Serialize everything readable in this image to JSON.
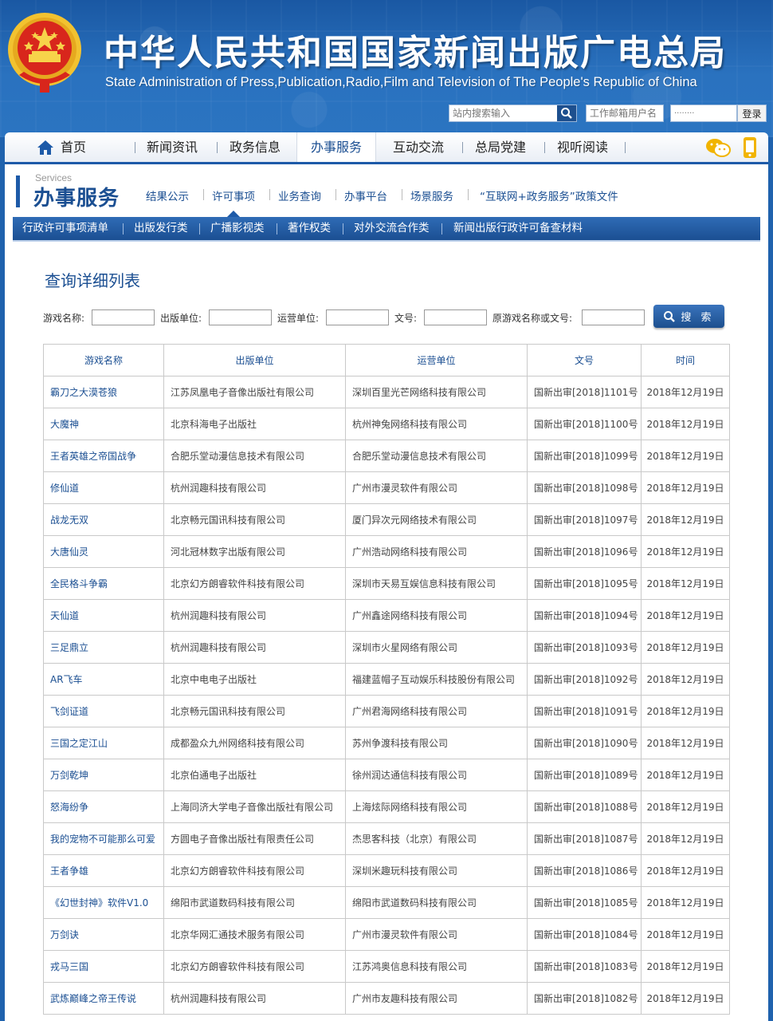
{
  "header": {
    "title_cn": "中华人民共和国国家新闻出版广电总局",
    "title_en": "State Administration of Press,Publication,Radio,Film and Television of The People's Republic of China",
    "search_placeholder": "站内搜索输入",
    "mail_placeholder": "工作邮箱用户名",
    "password_mask": "········",
    "login_label": "登录"
  },
  "nav": {
    "items": [
      "首页",
      "新闻资讯",
      "政务信息",
      "办事服务",
      "互动交流",
      "总局党建",
      "视听阅读"
    ],
    "active": "办事服务"
  },
  "section": {
    "en": "Services",
    "cn": "办事服务",
    "subnav": [
      "结果公示",
      "许可事项",
      "业务查询",
      "办事平台",
      "场景服务",
      "“互联网+政务服务”政策文件"
    ],
    "categories": [
      "行政许可事项清单",
      "出版发行类",
      "广播影视类",
      "著作权类",
      "对外交流合作类",
      "新闻出版行政许可备查材料"
    ]
  },
  "list": {
    "title": "查询详细列表",
    "filters": [
      "游戏名称:",
      "出版单位:",
      "运营单位:",
      "文号:",
      "原游戏名称或文号:"
    ],
    "search_button": "搜 索",
    "columns": [
      "游戏名称",
      "出版单位",
      "运营单位",
      "文号",
      "时间"
    ],
    "rows": [
      [
        "霸刀之大漠苍狼",
        "江苏凤凰电子音像出版社有限公司",
        "深圳百里光芒网络科技有限公司",
        "国新出审[2018]1101号",
        "2018年12月19日"
      ],
      [
        "大魔神",
        "北京科海电子出版社",
        "杭州神兔网络科技有限公司",
        "国新出审[2018]1100号",
        "2018年12月19日"
      ],
      [
        "王者英雄之帝国战争",
        "合肥乐堂动漫信息技术有限公司",
        "合肥乐堂动漫信息技术有限公司",
        "国新出审[2018]1099号",
        "2018年12月19日"
      ],
      [
        "修仙道",
        "杭州润趣科技有限公司",
        "广州市漫灵软件有限公司",
        "国新出审[2018]1098号",
        "2018年12月19日"
      ],
      [
        "战龙无双",
        "北京畅元国讯科技有限公司",
        "厦门异次元网络技术有限公司",
        "国新出审[2018]1097号",
        "2018年12月19日"
      ],
      [
        "大唐仙灵",
        "河北冠林数字出版有限公司",
        "广州浩动网络科技有限公司",
        "国新出审[2018]1096号",
        "2018年12月19日"
      ],
      [
        "全民格斗争霸",
        "北京幻方朗睿软件科技有限公司",
        "深圳市天易互娱信息科技有限公司",
        "国新出审[2018]1095号",
        "2018年12月19日"
      ],
      [
        "天仙道",
        "杭州润趣科技有限公司",
        "广州鑫途网络科技有限公司",
        "国新出审[2018]1094号",
        "2018年12月19日"
      ],
      [
        "三足鼎立",
        "杭州润趣科技有限公司",
        "深圳市火星网络有限公司",
        "国新出审[2018]1093号",
        "2018年12月19日"
      ],
      [
        "AR飞车",
        "北京中电电子出版社",
        "福建蓝帽子互动娱乐科技股份有限公司",
        "国新出审[2018]1092号",
        "2018年12月19日"
      ],
      [
        "飞剑证道",
        "北京畅元国讯科技有限公司",
        "广州君海网络科技有限公司",
        "国新出审[2018]1091号",
        "2018年12月19日"
      ],
      [
        "三国之定江山",
        "成都盈众九州网络科技有限公司",
        "苏州争渡科技有限公司",
        "国新出审[2018]1090号",
        "2018年12月19日"
      ],
      [
        "万剑乾坤",
        "北京伯通电子出版社",
        "徐州润达通信科技有限公司",
        "国新出审[2018]1089号",
        "2018年12月19日"
      ],
      [
        "怒海纷争",
        "上海同济大学电子音像出版社有限公司",
        "上海炫际网络科技有限公司",
        "国新出审[2018]1088号",
        "2018年12月19日"
      ],
      [
        "我的宠物不可能那么可爱",
        "方圆电子音像出版社有限责任公司",
        "杰思客科技（北京）有限公司",
        "国新出审[2018]1087号",
        "2018年12月19日"
      ],
      [
        "王者争雄",
        "北京幻方朗睿软件科技有限公司",
        "深圳米趣玩科技有限公司",
        "国新出审[2018]1086号",
        "2018年12月19日"
      ],
      [
        "《幻世封神》软件V1.0",
        "绵阳市武道数码科技有限公司",
        "绵阳市武道数码科技有限公司",
        "国新出审[2018]1085号",
        "2018年12月19日"
      ],
      [
        "万剑诀",
        "北京华网汇通技术服务有限公司",
        "广州市漫灵软件有限公司",
        "国新出审[2018]1084号",
        "2018年12月19日"
      ],
      [
        "戎马三国",
        "北京幻方朗睿软件科技有限公司",
        "江苏鸿奥信息科技有限公司",
        "国新出审[2018]1083号",
        "2018年12月19日"
      ],
      [
        "武炼巅峰之帝王传说",
        "杭州润趣科技有限公司",
        "广州市友趣科技有限公司",
        "国新出审[2018]1082号",
        "2018年12月19日"
      ]
    ]
  },
  "icons": {
    "emblem": "national-emblem",
    "search": "search-icon",
    "home": "home-icon",
    "wechat": "wechat-icon",
    "mobile": "mobile-icon"
  },
  "colors": {
    "brand_blue": "#1b4f92",
    "banner_blue": "#2a72bf",
    "emblem_red": "#d8261c",
    "emblem_gold": "#f2c230"
  }
}
